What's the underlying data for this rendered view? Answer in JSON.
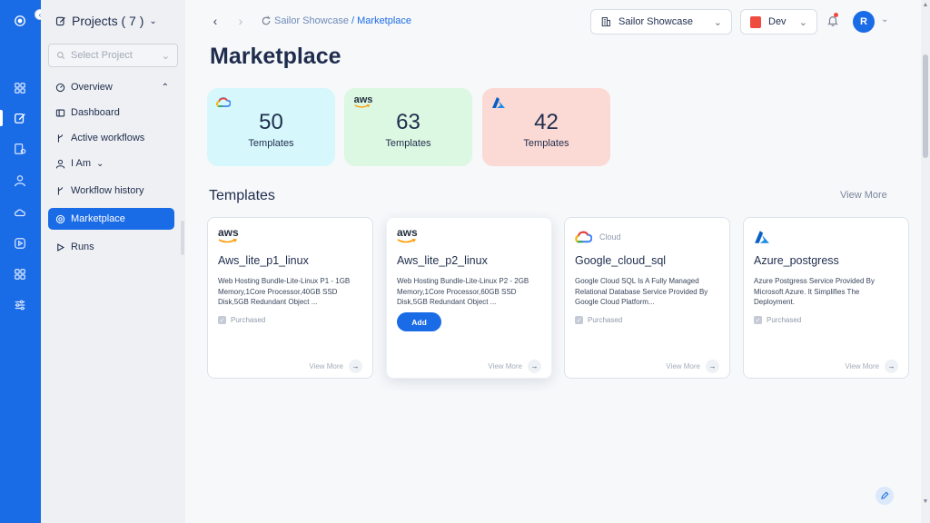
{
  "sidebar": {
    "project_title": "Projects ( 7 )",
    "select_placeholder": "Select Project",
    "items": [
      {
        "label": "Overview"
      },
      {
        "label": "Dashboard"
      },
      {
        "label": "Active workflows"
      },
      {
        "label": "I Am"
      },
      {
        "label": "Workflow history"
      },
      {
        "label": "Marketplace"
      },
      {
        "label": "Runs"
      }
    ]
  },
  "header": {
    "breadcrumb_parent": "Sailor Showcase",
    "breadcrumb_sep": "/",
    "breadcrumb_current": "Marketplace",
    "org_select": "Sailor Showcase",
    "env_select": "Dev",
    "avatar_initial": "R"
  },
  "page": {
    "title": "Marketplace"
  },
  "stats": [
    {
      "provider": "gcp",
      "count": "50",
      "label": "Templates"
    },
    {
      "provider": "aws",
      "count": "63",
      "label": "Templates"
    },
    {
      "provider": "azure",
      "count": "42",
      "label": "Templates"
    }
  ],
  "templates_section": {
    "title": "Templates",
    "view_more": "View More"
  },
  "cards": [
    {
      "logo_text": "aws",
      "title": "Aws_lite_p1_linux",
      "description": "Web Hosting Bundle-Lite-Linux P1 - 1GB Memory,1Core Processor,40GB SSD Disk,5GB Redundant Object ...",
      "status": "Purchased",
      "view_more": "View More"
    },
    {
      "logo_text": "aws",
      "title": "Aws_lite_p2_linux",
      "description": "Web Hosting Bundle-Lite-Linux P2 - 2GB Memory,1Core Processor,60GB SSD Disk,5GB Redundant Object ...",
      "button": "Add",
      "view_more": "View More"
    },
    {
      "logo_text": "Cloud",
      "title": "Google_cloud_sql",
      "description": "Google Cloud SQL Is A Fully Managed Relational Database Service Provided By Google Cloud Platform...",
      "status": "Purchased",
      "view_more": "View More"
    },
    {
      "title": "Azure_postgress",
      "description": "Azure Postgress Service Provided By Microsoft Azure. It Simplifies The Deployment.",
      "status": "Purchased",
      "view_more": "View More"
    }
  ],
  "colors": {
    "primary": "#1a6be6",
    "gcp_card": "#d6f7fb",
    "aws_card": "#dcf7e2",
    "azure_card": "#fbd9d5",
    "env_accent": "#ef4b3f"
  }
}
